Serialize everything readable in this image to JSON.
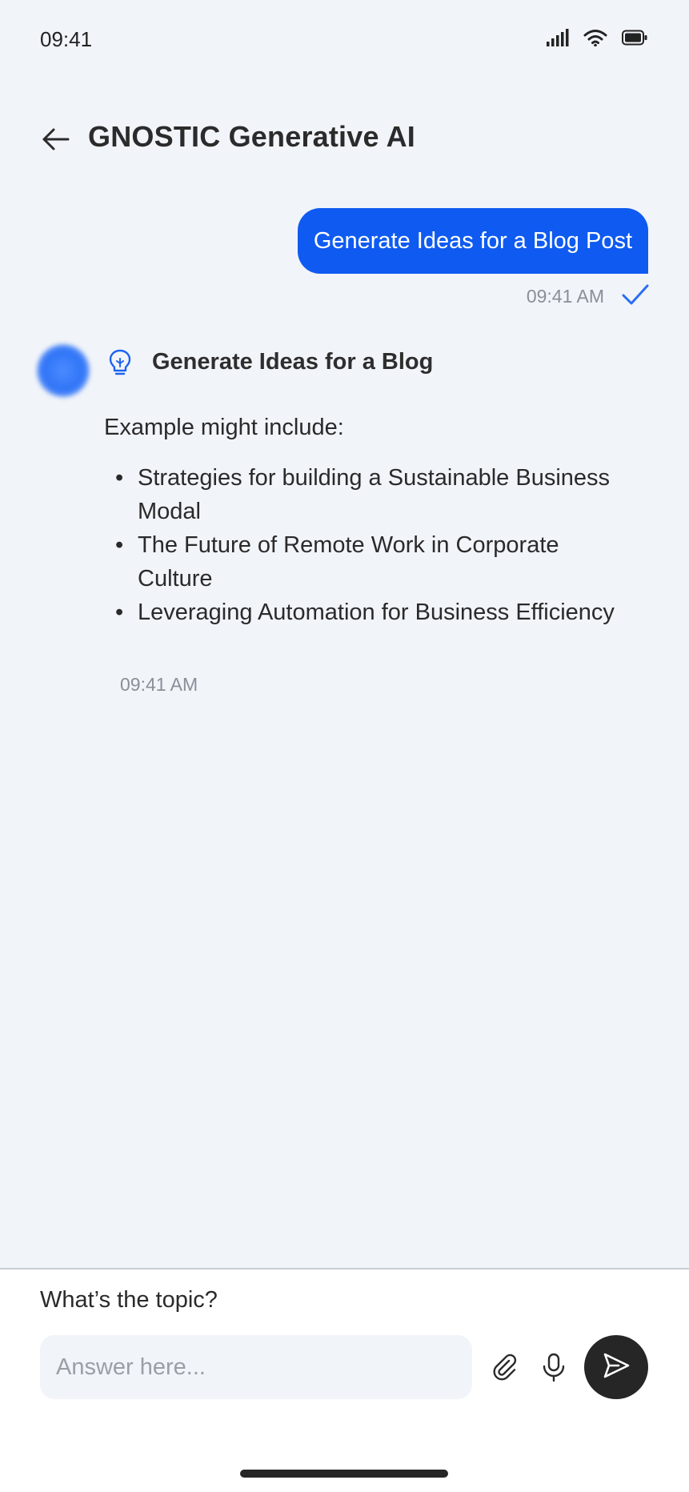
{
  "status_bar": {
    "time": "09:41",
    "icons": [
      "signal-icon",
      "wifi-icon",
      "battery-icon"
    ]
  },
  "header": {
    "title": "GNOSTIC Generative AI",
    "back_icon": "arrow-left-icon"
  },
  "conversation": {
    "user_message": {
      "text": "Generate Ideas for a Blog Post",
      "time": "09:41 AM",
      "status_icon": "check-icon"
    },
    "bot_message": {
      "icon": "lightbulb-icon",
      "heading": "Generate Ideas for a Blog",
      "intro": "Example might include:",
      "items": [
        "Strategies for building a Sustainable Business Modal",
        "The Future of Remote Work in Corporate Culture",
        "Leveraging Automation for Business Efficiency"
      ],
      "time": "09:41 AM"
    }
  },
  "composer": {
    "question": "What’s the topic?",
    "placeholder": "Answer here...",
    "value": "",
    "icons": [
      "paperclip-icon",
      "microphone-icon",
      "send-icon"
    ]
  },
  "colors": {
    "accent": "#0F5BF1",
    "background": "#F1F4F9",
    "send_button": "#262626"
  }
}
